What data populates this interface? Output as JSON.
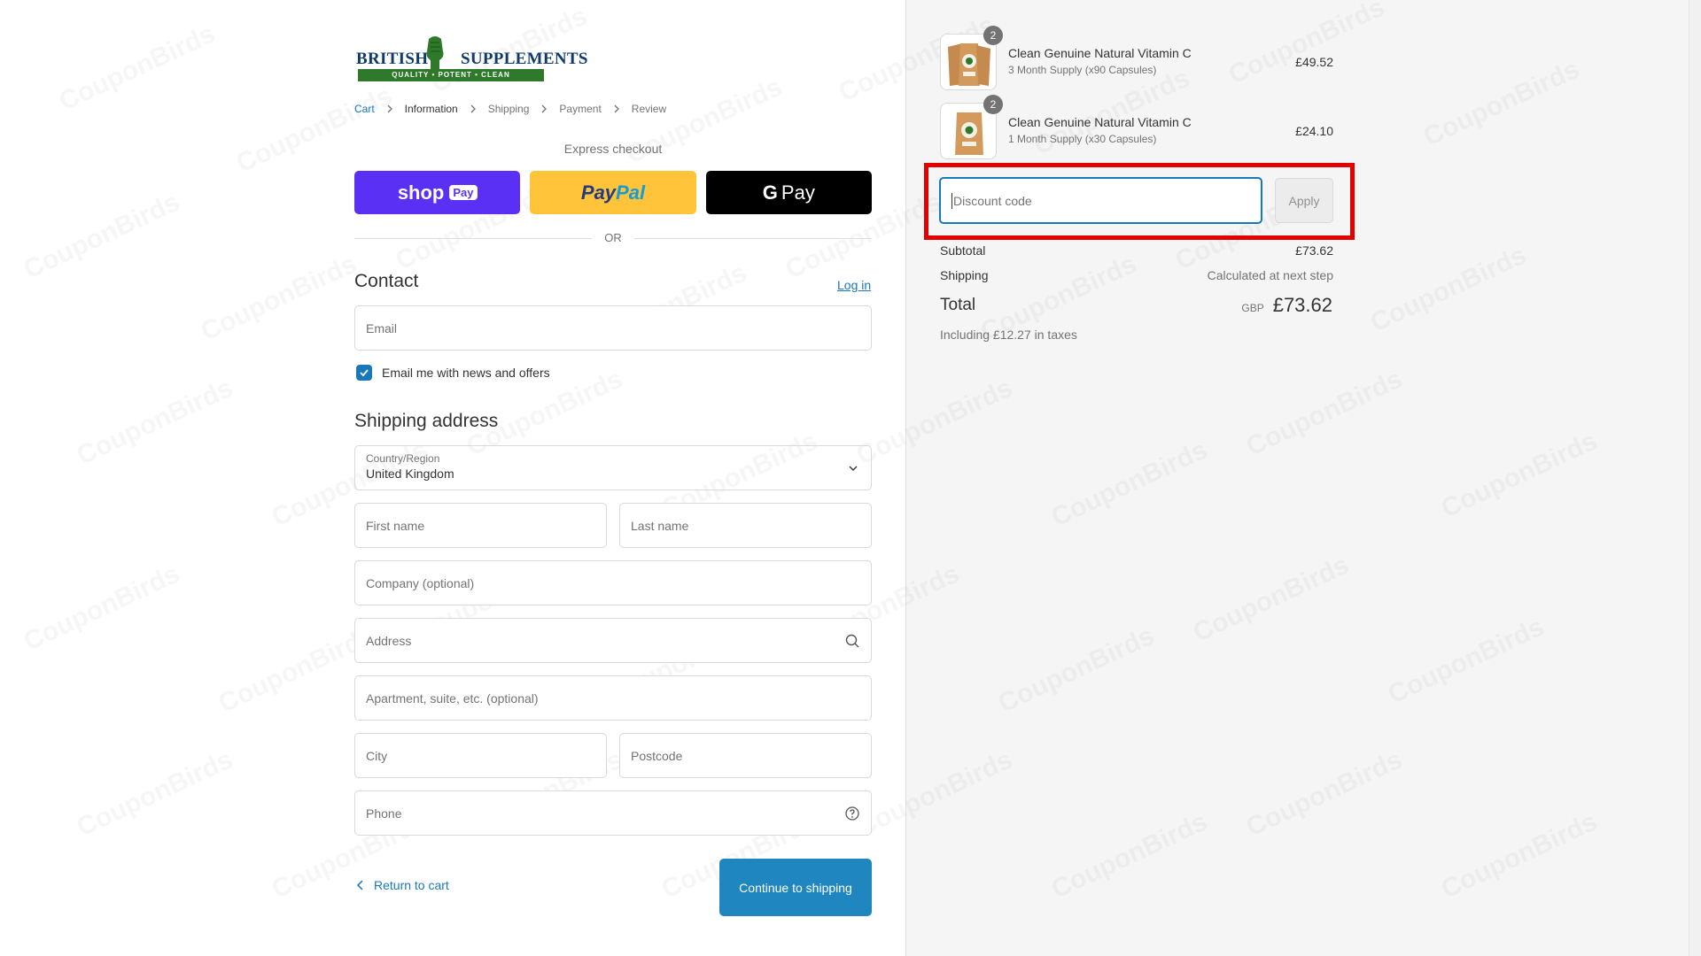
{
  "logo": {
    "word1": "BRITISH",
    "word2": "SUPPLEMENTS",
    "tagline": "QUALITY • POTENT • CLEAN"
  },
  "breadcrumb": [
    {
      "label": "Cart",
      "state": "link"
    },
    {
      "label": "Information",
      "state": "active"
    },
    {
      "label": "Shipping",
      "state": "muted"
    },
    {
      "label": "Payment",
      "state": "muted"
    },
    {
      "label": "Review",
      "state": "muted"
    }
  ],
  "express": {
    "title": "Express checkout",
    "shop_pay": {
      "word": "shop",
      "pill": "Pay"
    },
    "paypal": {
      "p1": "Pay",
      "p2": "Pal"
    },
    "gpay": {
      "g": "G",
      "word": "Pay"
    },
    "or": "OR"
  },
  "contact": {
    "heading": "Contact",
    "login": "Log in",
    "email_placeholder": "Email",
    "newsletter_label": "Email me with news and offers",
    "newsletter_checked": true
  },
  "shipping": {
    "heading": "Shipping address",
    "country_label": "Country/Region",
    "country_value": "United Kingdom",
    "first_name": "First name",
    "last_name": "Last name",
    "company": "Company (optional)",
    "address": "Address",
    "apartment": "Apartment, suite, etc. (optional)",
    "city": "City",
    "postcode": "Postcode",
    "phone": "Phone"
  },
  "actions": {
    "return": "Return to cart",
    "continue": "Continue to shipping"
  },
  "cart": {
    "items": [
      {
        "name": "Clean Genuine Natural Vitamin C",
        "variant": "3 Month Supply (x90 Capsules)",
        "price": "£49.52",
        "qty": "2"
      },
      {
        "name": "Clean Genuine Natural Vitamin C",
        "variant": "1 Month Supply (x30 Capsules)",
        "price": "£24.10",
        "qty": "2"
      }
    ],
    "discount_placeholder": "Discount code",
    "apply": "Apply",
    "subtotal_label": "Subtotal",
    "subtotal": "£73.62",
    "shipping_label": "Shipping",
    "shipping_value": "Calculated at next step",
    "total_label": "Total",
    "currency": "GBP",
    "total": "£73.62",
    "taxes": "Including £12.27 in taxes"
  },
  "watermark": "CouponBirds",
  "colors": {
    "accent": "#1878b9",
    "highlight": "#e30000",
    "shop_pay": "#5a31f4",
    "paypal": "#ffc439"
  }
}
